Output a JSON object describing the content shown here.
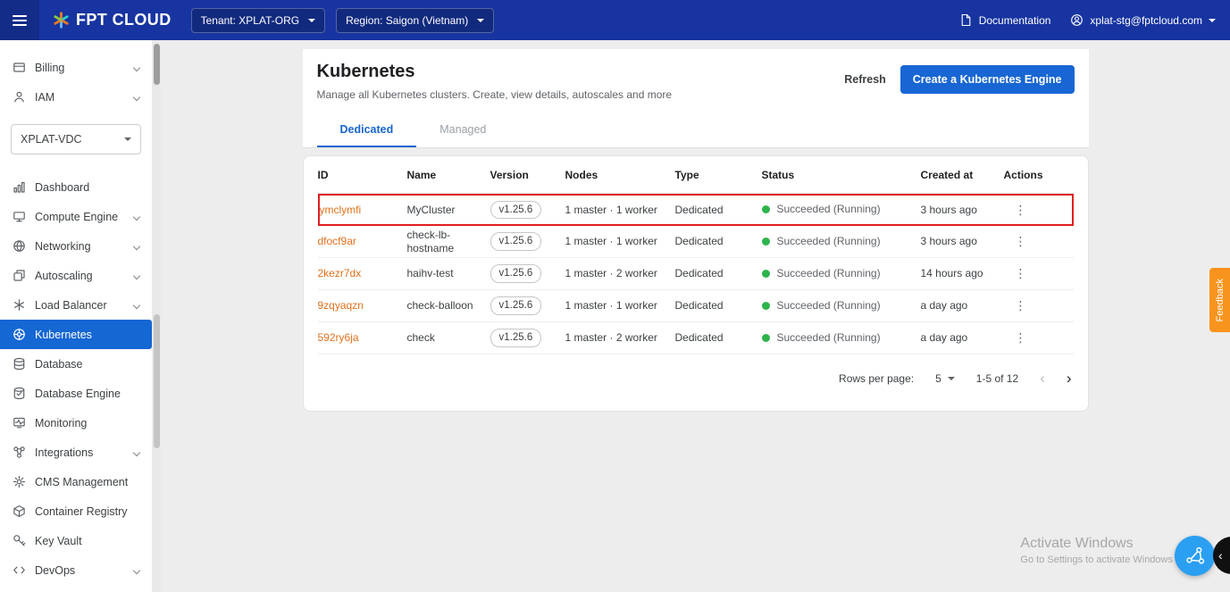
{
  "topbar": {
    "brand": "FPT CLOUD",
    "tenant_label": "Tenant: XPLAT-ORG",
    "region_label": "Region: Saigon (Vietnam)",
    "documentation_label": "Documentation",
    "account_email": "xplat-stg@fptcloud.com"
  },
  "sidebar": {
    "top_items": [
      {
        "label": "Billing",
        "icon": "billing-icon",
        "expandable": true
      },
      {
        "label": "IAM",
        "icon": "iam-icon",
        "expandable": true
      }
    ],
    "vdc_value": "XPLAT-VDC",
    "items": [
      {
        "label": "Dashboard",
        "icon": "dashboard-icon",
        "expandable": false,
        "active": false
      },
      {
        "label": "Compute Engine",
        "icon": "compute-engine-icon",
        "expandable": true,
        "active": false
      },
      {
        "label": "Networking",
        "icon": "networking-icon",
        "expandable": true,
        "active": false
      },
      {
        "label": "Autoscaling",
        "icon": "autoscaling-icon",
        "expandable": true,
        "active": false
      },
      {
        "label": "Load Balancer",
        "icon": "load-balancer-icon",
        "expandable": true,
        "active": false
      },
      {
        "label": "Kubernetes",
        "icon": "kubernetes-icon",
        "expandable": false,
        "active": true
      },
      {
        "label": "Database",
        "icon": "database-icon",
        "expandable": false,
        "active": false
      },
      {
        "label": "Database Engine",
        "icon": "database-engine-icon",
        "expandable": false,
        "active": false
      },
      {
        "label": "Monitoring",
        "icon": "monitoring-icon",
        "expandable": false,
        "active": false
      },
      {
        "label": "Integrations",
        "icon": "integrations-icon",
        "expandable": true,
        "active": false
      },
      {
        "label": "CMS Management",
        "icon": "cms-management-icon",
        "expandable": false,
        "active": false
      },
      {
        "label": "Container Registry",
        "icon": "container-registry-icon",
        "expandable": false,
        "active": false
      },
      {
        "label": "Key Vault",
        "icon": "key-vault-icon",
        "expandable": false,
        "active": false
      },
      {
        "label": "DevOps",
        "icon": "devops-icon",
        "expandable": true,
        "active": false
      }
    ]
  },
  "main": {
    "title": "Kubernetes",
    "subtitle": "Manage all Kubernetes clusters. Create, view details, autoscales and more",
    "refresh_label": "Refresh",
    "create_button_label": "Create a Kubernetes Engine",
    "tabs": [
      {
        "label": "Dedicated",
        "active": true
      },
      {
        "label": "Managed",
        "active": false
      }
    ],
    "table": {
      "headers": [
        "ID",
        "Name",
        "Version",
        "Nodes",
        "Type",
        "Status",
        "Created at",
        "Actions"
      ],
      "rows": [
        {
          "id": "ymclymfi",
          "name": "MyCluster",
          "version": "v1.25.6",
          "nodes": "1 master · 1 worker",
          "type": "Dedicated",
          "status": "Succeeded (Running)",
          "created_at": "3 hours ago",
          "highlighted": true
        },
        {
          "id": "dfocf9ar",
          "name": "check-lb-hostname",
          "version": "v1.25.6",
          "nodes": "1 master · 1 worker",
          "type": "Dedicated",
          "status": "Succeeded (Running)",
          "created_at": "3 hours ago",
          "highlighted": false
        },
        {
          "id": "2kezr7dx",
          "name": "haihv-test",
          "version": "v1.25.6",
          "nodes": "1 master · 2 worker",
          "type": "Dedicated",
          "status": "Succeeded (Running)",
          "created_at": "14 hours ago",
          "highlighted": false
        },
        {
          "id": "9zqyaqzn",
          "name": "check-balloon",
          "version": "v1.25.6",
          "nodes": "1 master · 1 worker",
          "type": "Dedicated",
          "status": "Succeeded (Running)",
          "created_at": "a day ago",
          "highlighted": false
        },
        {
          "id": "592ry6ja",
          "name": "check",
          "version": "v1.25.6",
          "nodes": "1 master · 2 worker",
          "type": "Dedicated",
          "status": "Succeeded (Running)",
          "created_at": "a day ago",
          "highlighted": false
        }
      ]
    },
    "pagination": {
      "rows_per_page_label": "Rows per page:",
      "rows_per_page_value": "5",
      "range_label": "1-5 of 12"
    }
  },
  "feedback_label": "Feedback",
  "watermark": {
    "line1": "Activate Windows",
    "line2": "Go to Settings to activate Windows"
  },
  "colors": {
    "topbar_blue": "#1734a0",
    "accent_blue": "#1766d3",
    "link_orange": "#e2711d",
    "status_green": "#2db44b",
    "highlight_red": "#e01e1e",
    "feedback_orange": "#f7941d"
  }
}
